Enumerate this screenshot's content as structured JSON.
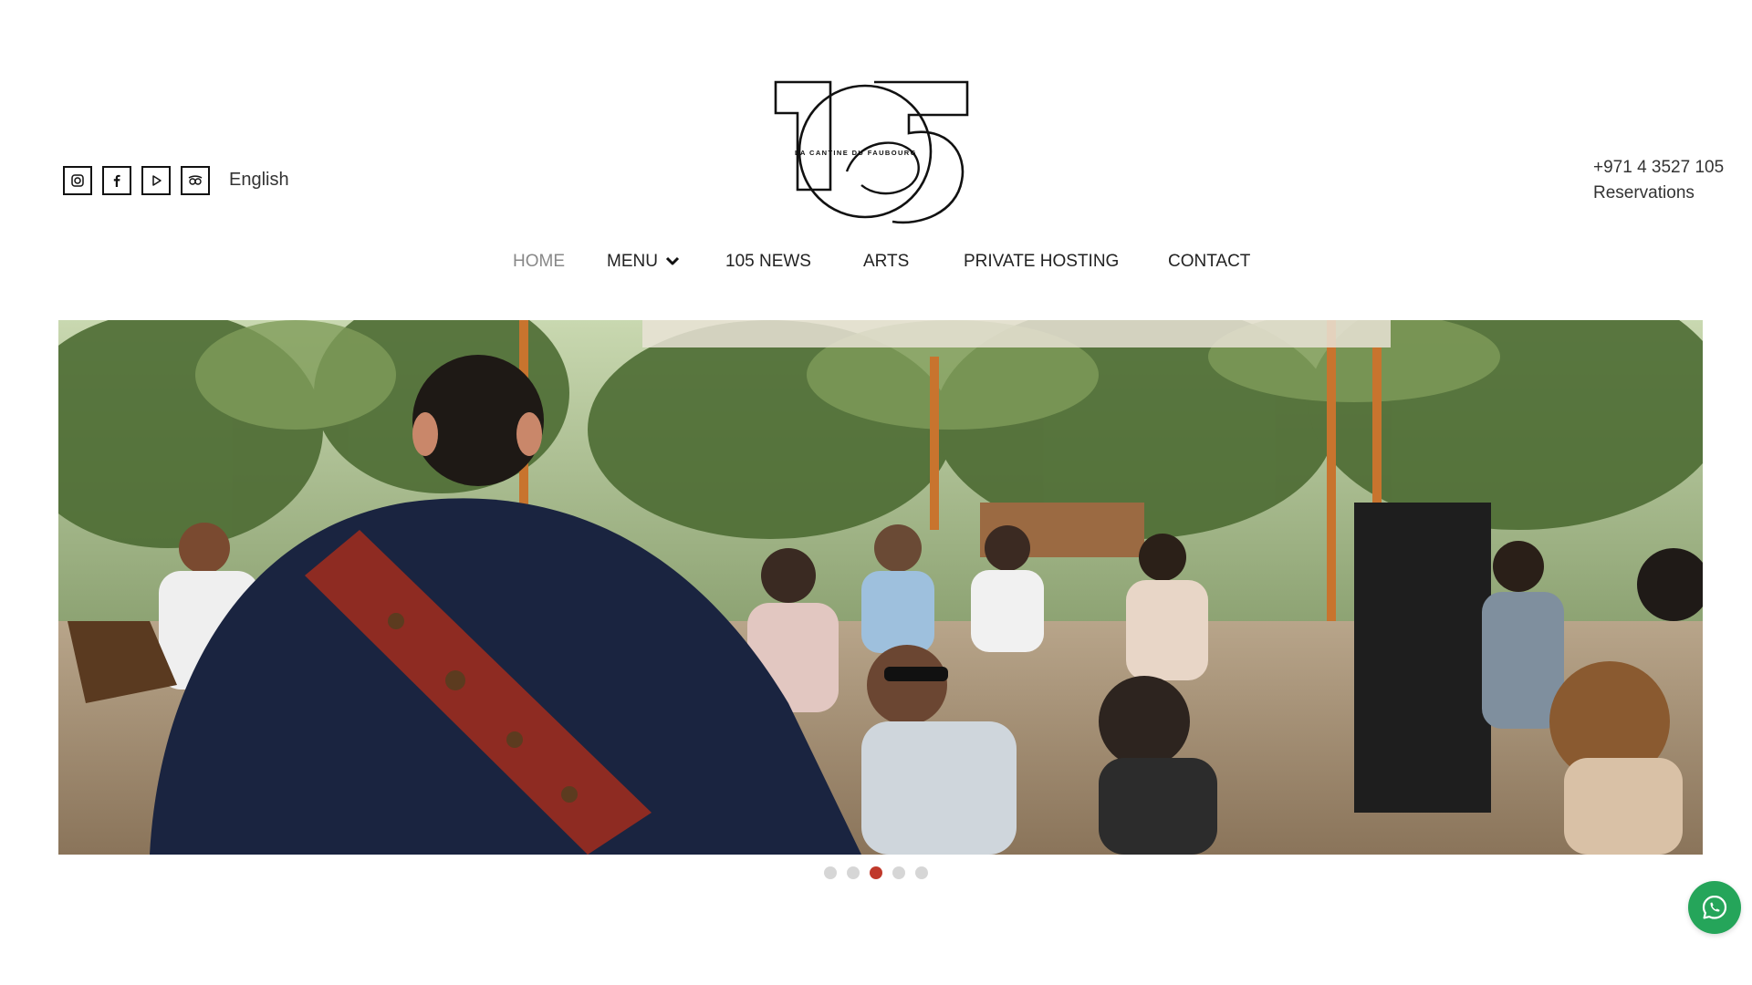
{
  "header": {
    "language": "English",
    "logo_text": "LA CANTINE DU FAUBOURG",
    "phone": "+971 4 3527 105",
    "reservations": "Reservations",
    "socials": [
      "instagram-icon",
      "facebook-icon",
      "youtube-icon",
      "tripadvisor-icon"
    ]
  },
  "nav": {
    "items": [
      {
        "label": "HOME",
        "active": true
      },
      {
        "label": "MENU",
        "active": false,
        "has_dropdown": true
      },
      {
        "label": "105 NEWS",
        "active": false
      },
      {
        "label": "ARTS",
        "active": false
      },
      {
        "label": "PRIVATE HOSTING",
        "active": false
      },
      {
        "label": "CONTACT",
        "active": false
      }
    ]
  },
  "carousel": {
    "slide_count": 5,
    "active_index": 2
  },
  "colors": {
    "accent_red": "#c0392b",
    "dot_inactive": "#d6d6d6",
    "whatsapp_green": "#25a55a",
    "text": "#222222"
  }
}
